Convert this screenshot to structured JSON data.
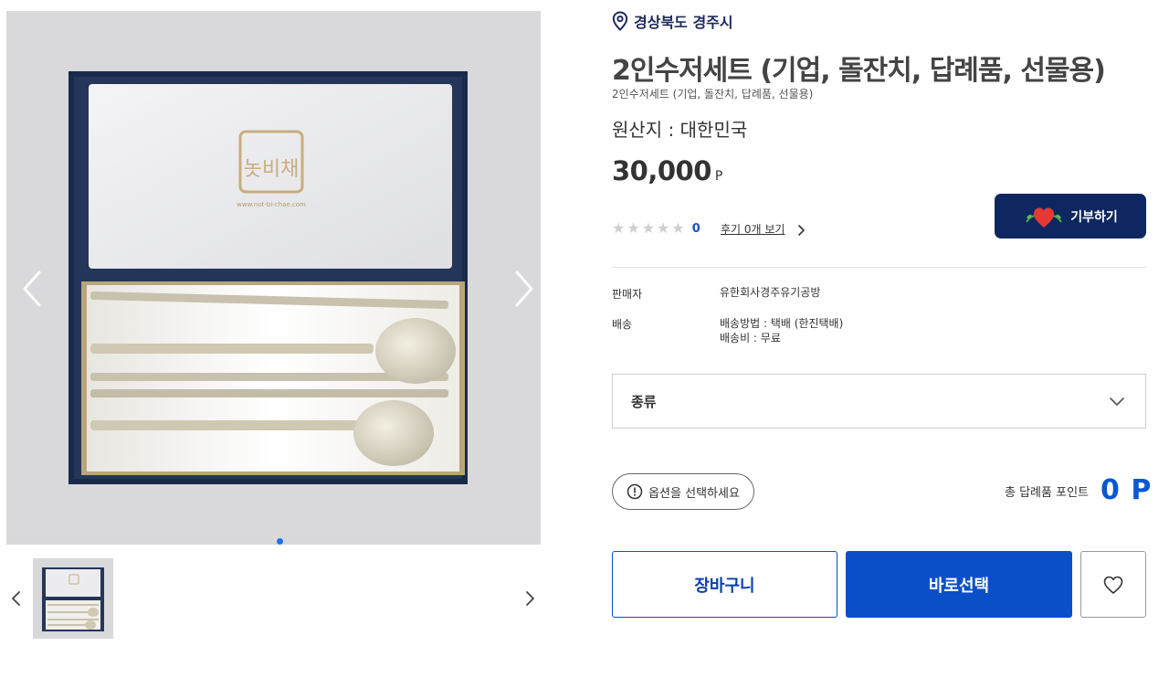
{
  "gallery": {
    "box_brand_text": "놋비채",
    "box_url_text": "www.not-bi-chae.com",
    "prev_icon": "chevron-left-icon",
    "next_icon": "chevron-right-icon",
    "active_dot_color": "#1a73e8",
    "slide_count": 1,
    "active_slide": 1
  },
  "product": {
    "location": "경상북도 경주시",
    "title": "2인수저세트 (기업, 돌잔치, 답례품, 선물용)",
    "subtitle": "2인수저세트 (기업, 돌잔치, 답례품, 선물용)",
    "origin": "원산지 : 대한민국",
    "price": "30,000",
    "price_unit": "P",
    "rating_stars": 0,
    "rating_count": "0",
    "review_link": "후기 0개 보기",
    "donate_label": "기부하기"
  },
  "info": {
    "seller_label": "판매자",
    "seller_value": "유한회사경주유기공방",
    "shipping_label": "배송",
    "shipping_method": "배송방법 : 택배 (한진택배)",
    "shipping_fee": "배송비 : 무료"
  },
  "options": {
    "select_label": "종류",
    "notice": "옵션을 선택하세요",
    "total_label": "총 답례품 포인트",
    "total_value": "0 P"
  },
  "actions": {
    "cart_label": "장바구니",
    "buy_label": "바로선택",
    "wish_icon": "heart-icon"
  },
  "colors": {
    "primary": "#0a4fc8",
    "navy": "#0f2760",
    "points": "#0b57d0"
  }
}
